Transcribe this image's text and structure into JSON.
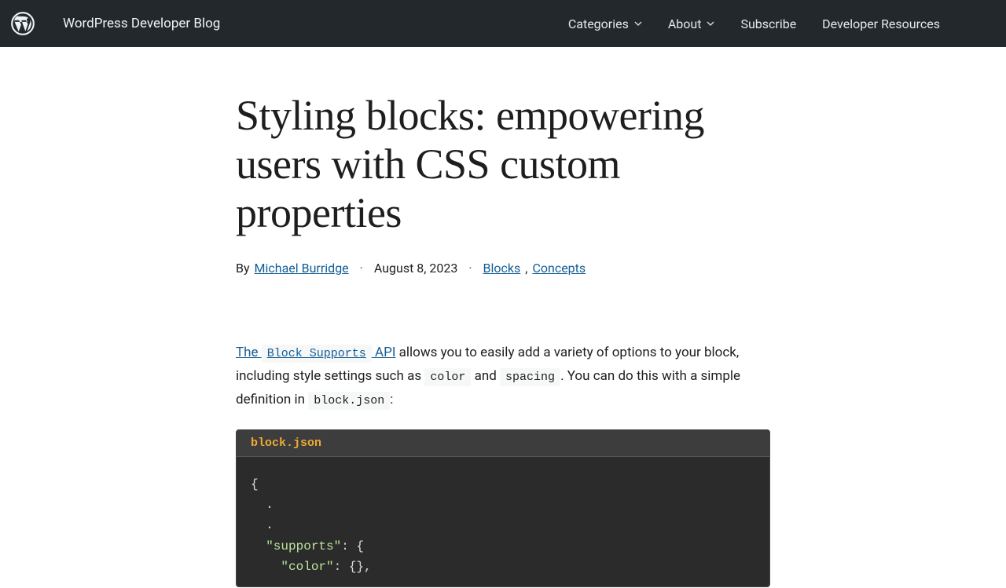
{
  "header": {
    "site_title": "WordPress Developer Blog",
    "nav": {
      "categories": "Categories",
      "about": "About",
      "subscribe": "Subscribe",
      "dev_resources": "Developer Resources"
    }
  },
  "post": {
    "title": "Styling blocks: empowering users with CSS custom properties",
    "byline_prefix": "By",
    "author": "Michael Burridge",
    "date": "August 8, 2023",
    "categories": {
      "blocks": "Blocks",
      "concepts": "Concepts"
    },
    "sep": "·",
    "comma": ","
  },
  "body": {
    "link_text_pre": "The ",
    "link_code": "Block Supports",
    "link_text_post": " API",
    "sentence1_a": " allows you to easily add a variety of options to your block, including style settings such as ",
    "code_color": "color",
    "and": " and ",
    "code_spacing": "spacing",
    "sentence1_b": ". You can do this with a simple definition in ",
    "code_blockjson": "block.json",
    "sentence1_c": ":"
  },
  "codeblock": {
    "filename": "block.json",
    "lines": {
      "l1": "{",
      "l2": "  .",
      "l3": "  .",
      "l4a": "  ",
      "l4key": "\"supports\"",
      "l4b": ": {",
      "l5a": "    ",
      "l5key": "\"color\"",
      "l5b": ": {},"
    }
  }
}
